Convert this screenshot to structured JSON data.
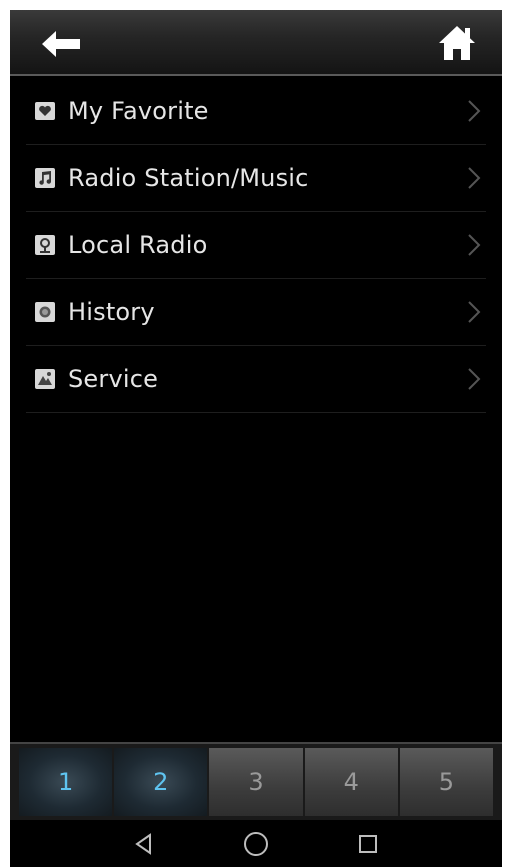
{
  "header": {
    "back_icon": "back-arrow-icon",
    "home_icon": "home-icon"
  },
  "menu": {
    "items": [
      {
        "label": "My Favorite",
        "icon": "heart-icon"
      },
      {
        "label": "Radio Station/Music",
        "icon": "music-note-icon"
      },
      {
        "label": "Local Radio",
        "icon": "location-pin-icon"
      },
      {
        "label": "History",
        "icon": "history-icon"
      },
      {
        "label": "Service",
        "icon": "service-icon"
      }
    ]
  },
  "tabs": {
    "items": [
      {
        "label": "1",
        "active": true
      },
      {
        "label": "2",
        "active": true
      },
      {
        "label": "3",
        "active": false
      },
      {
        "label": "4",
        "active": false
      },
      {
        "label": "5",
        "active": false
      }
    ],
    "active_color": "#5fc4f0",
    "inactive_color": "#9a9a9a"
  },
  "navbar": {
    "icons": [
      "nav-back-icon",
      "nav-home-icon",
      "nav-recents-icon"
    ]
  }
}
